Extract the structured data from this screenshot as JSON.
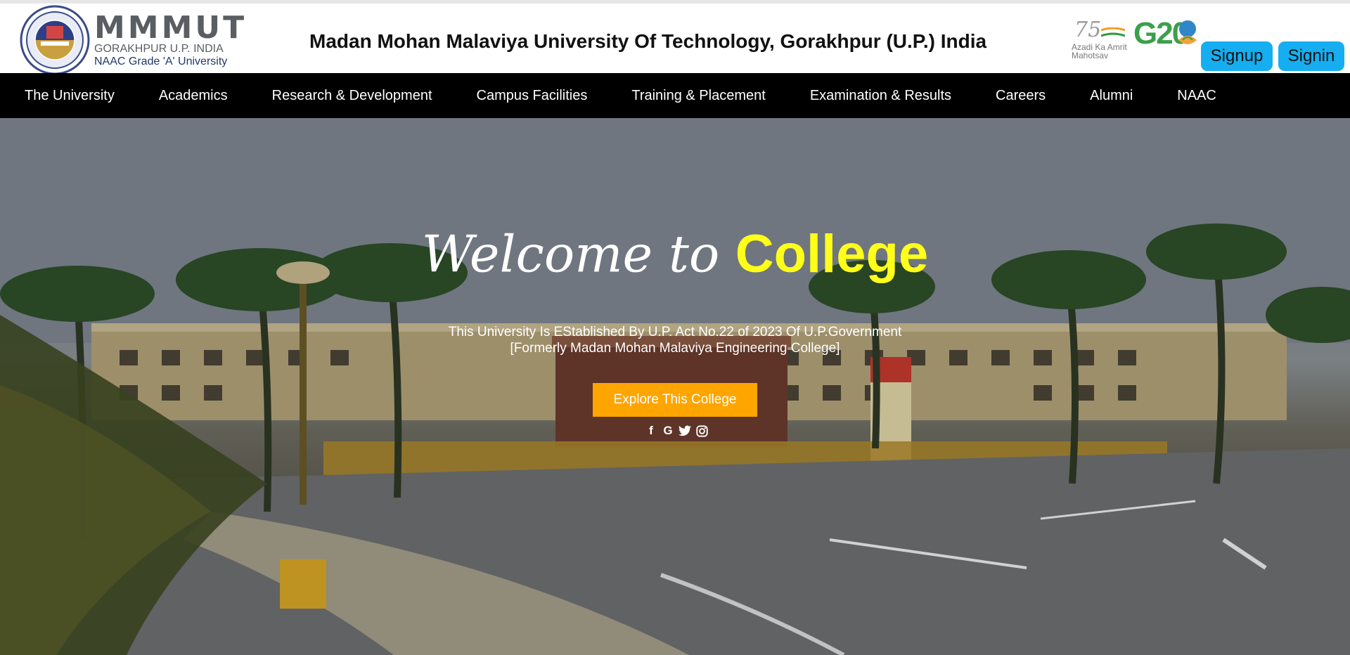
{
  "header": {
    "logo": {
      "name": "MMMUT",
      "place": "GORAKHPUR U.P. INDIA",
      "grade": "NAAC Grade 'A' University"
    },
    "title": "Madan Mohan Malaviya University Of Technology, Gorakhpur (U.P.) India",
    "azadi": {
      "number": "75",
      "text": "Azadi Ka Amrit Mahotsav"
    },
    "g20": {
      "text": "G20"
    },
    "signup_label": "Signup",
    "signin_label": "Signin"
  },
  "nav": {
    "items": [
      {
        "label": "The University"
      },
      {
        "label": "Academics"
      },
      {
        "label": "Research & Development"
      },
      {
        "label": "Campus Facilities"
      },
      {
        "label": "Training & Placement"
      },
      {
        "label": "Examination & Results"
      },
      {
        "label": "Careers"
      },
      {
        "label": "Alumni"
      },
      {
        "label": "NAAC"
      }
    ]
  },
  "hero": {
    "welcome_script": "Welcome to",
    "welcome_highlight": "College",
    "line1": "This University Is EStablished By U.P. Act No.22 of 2023 Of U.P.Government",
    "line2": "[Formerly Madan Mohan Malaviya Engineering College]",
    "explore_label": "Explore This College",
    "social": {
      "facebook": "f",
      "google": "G"
    }
  },
  "colors": {
    "nav_bg": "#000000",
    "top_button": "#16aef0",
    "explore_button": "#ffa500",
    "highlight": "#ffff1a"
  }
}
